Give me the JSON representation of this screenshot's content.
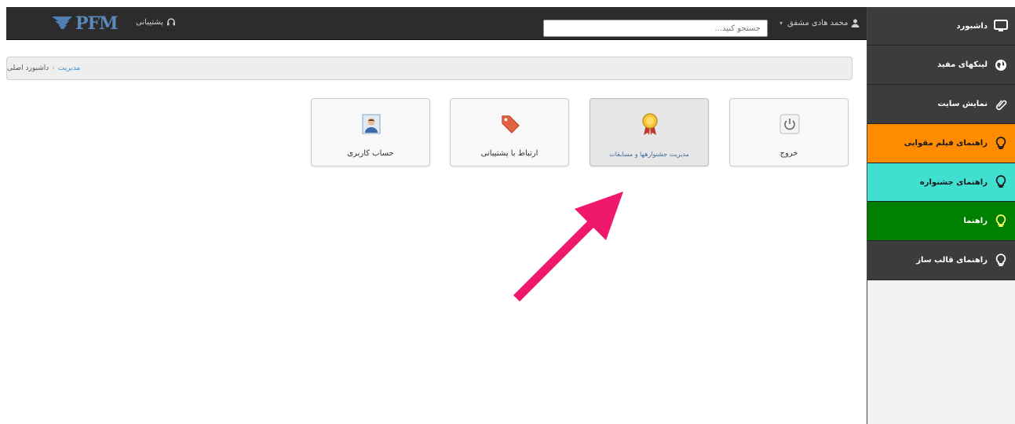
{
  "topbar": {
    "logo_text": "PFM",
    "support_label": "پشتیبانی",
    "search_placeholder": "جستجو کنید...",
    "user_name": "محمد هادی مشفق",
    "user_caret": "▾"
  },
  "sidebar": {
    "items": [
      {
        "label": "داشبورد",
        "color": "#3c3c3c",
        "text_color": "#ffffff",
        "icon": "monitor-icon"
      },
      {
        "label": "لینکهای مفید",
        "color": "#3c3c3c",
        "text_color": "#ffffff",
        "icon": "globe-icon"
      },
      {
        "label": "نمایش سایت",
        "color": "#3c3c3c",
        "text_color": "#ffffff",
        "icon": "paperclip-icon"
      },
      {
        "label": "راهنمای فیلم مقوایی",
        "color": "#ff8c00",
        "text_color": "#1a1a1a",
        "icon": "lightbulb-icon"
      },
      {
        "label": "راهنمای جشنواره",
        "color": "#40e0d0",
        "text_color": "#1a1a1a",
        "icon": "lightbulb-icon"
      },
      {
        "label": "راهنما",
        "color": "#008000",
        "text_color": "#ffffff",
        "icon": "lightbulb-icon"
      },
      {
        "label": "راهنمای قالب ساز",
        "color": "#3c3c3c",
        "text_color": "#ffffff",
        "icon": "lightbulb-icon"
      }
    ]
  },
  "breadcrumb": {
    "root": "مدیریت",
    "separator": "›",
    "current": "داشبورد اصلی"
  },
  "tiles": [
    {
      "label": "خروج",
      "icon": "power-icon",
      "active": false
    },
    {
      "label": "مدیریت جشنوارهها و مسابقات",
      "icon": "award-icon",
      "active": true
    },
    {
      "label": "ارتباط با پشتیبانی",
      "icon": "tag-icon",
      "active": false
    },
    {
      "label": "حساب کاربری",
      "icon": "user-profile-icon",
      "active": false
    }
  ],
  "colors": {
    "topbar": "#2c2c2c",
    "accent_link": "#3f8fc8",
    "arrow": "#f0186c"
  }
}
